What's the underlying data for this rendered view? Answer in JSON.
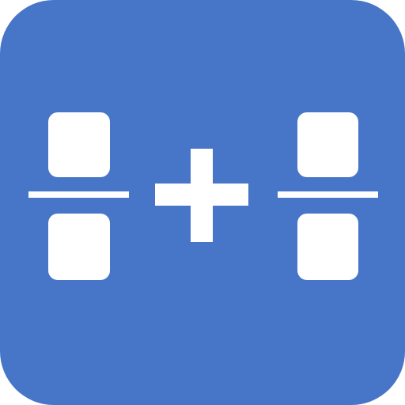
{
  "app": {
    "icon_name": "fraction-addition-app-icon",
    "background_color": "#4775c8",
    "glyph_color": "#ffffff",
    "operator": "plus"
  }
}
